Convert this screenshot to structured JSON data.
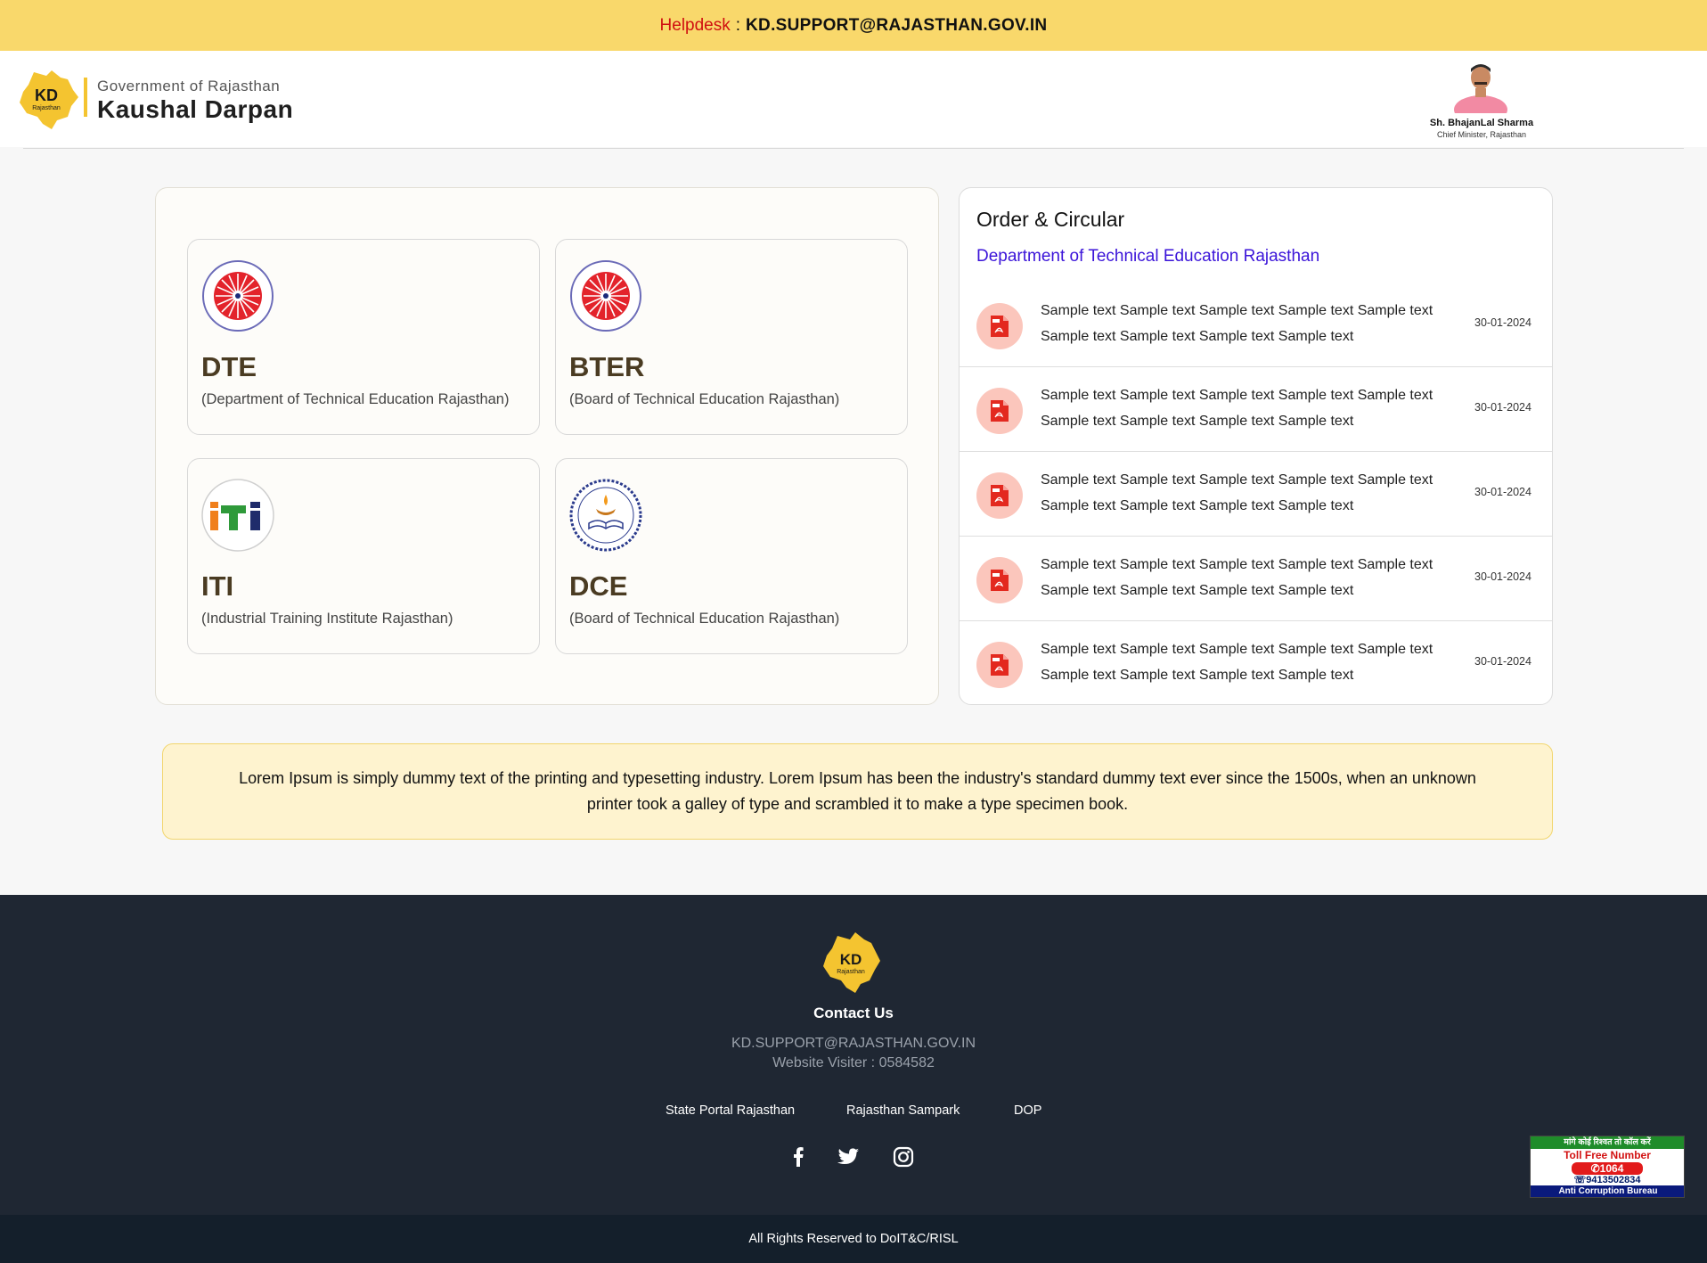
{
  "helpdesk": {
    "label": "Helpdesk",
    "separator": ":",
    "email": "KD.SUPPORT@RAJASTHAN.GOV.IN"
  },
  "header": {
    "logo_text": "KD",
    "logo_subtext": "Rajasthan",
    "brand_sub": "Government of Rajasthan",
    "brand_main": "Kaushal Darpan",
    "cm_name": "Sh. BhajanLal Sharma",
    "cm_title": "Chief Minister, Rajasthan"
  },
  "departments": [
    {
      "abbr": "DTE",
      "full": "(Department of Technical Education Rajasthan)",
      "icon": "dte-emblem-icon"
    },
    {
      "abbr": "BTER",
      "full": "(Board of Technical Education Rajasthan)",
      "icon": "bter-emblem-icon"
    },
    {
      "abbr": "ITI",
      "full": "(Industrial Training Institute Rajasthan)",
      "icon": "iti-logo-icon"
    },
    {
      "abbr": "DCE",
      "full": "(Board of Technical Education Rajasthan)",
      "icon": "dce-emblem-icon"
    }
  ],
  "orders": {
    "title": "Order & Circular",
    "subtitle": "Department of Technical Education Rajasthan",
    "items": [
      {
        "text": "Sample text Sample text Sample text Sample text Sample text Sample text Sample text Sample text Sample text",
        "date": "30-01-2024"
      },
      {
        "text": "Sample text Sample text Sample text Sample text Sample text Sample text Sample text Sample text Sample text",
        "date": "30-01-2024"
      },
      {
        "text": "Sample text Sample text Sample text Sample text Sample text Sample text Sample text Sample text Sample text",
        "date": "30-01-2024"
      },
      {
        "text": "Sample text Sample text Sample text Sample text Sample text Sample text Sample text Sample text Sample text",
        "date": "30-01-2024"
      },
      {
        "text": "Sample text Sample text Sample text Sample text Sample text Sample text Sample text Sample text Sample text",
        "date": "30-01-2024"
      }
    ]
  },
  "notice": {
    "text": "Lorem Ipsum is simply dummy text of the printing and typesetting industry. Lorem Ipsum has been the industry's standard dummy text ever since the 1500s, when an unknown printer took a galley of type and scrambled it to make a type specimen book."
  },
  "footer": {
    "logo_text": "KD",
    "logo_subtext": "Rajasthan",
    "contact_title": "Contact Us",
    "email": "KD.SUPPORT@RAJASTHAN.GOV.IN",
    "visitor_label": "Website Visiter :",
    "visitor_count": "0584582",
    "links": [
      "State Portal Rajasthan",
      "Rajasthan Sampark",
      "DOP"
    ],
    "social": [
      "facebook-icon",
      "twitter-icon",
      "instagram-icon"
    ],
    "copyright": "All Rights Reserved to DoIT&C/RISL"
  },
  "acb": {
    "top": "मांगे कोई रिश्वत तो कॉल करें",
    "toll": "Toll Free Number",
    "number": "1064",
    "phone": "9413502834",
    "bottom": "Anti Corruption Bureau"
  },
  "colors": {
    "helpbar": "#f9d86b",
    "accent_purple": "#3b14d9",
    "footer": "#1f2733",
    "brand_yellow": "#f4c430"
  }
}
